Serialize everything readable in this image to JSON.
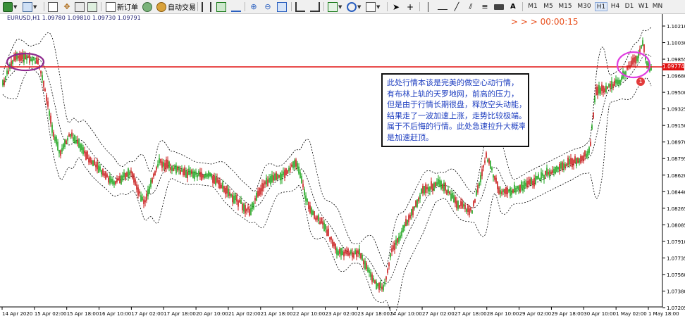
{
  "toolbar": {
    "new_order_label": "新订单",
    "auto_trade_label": "自动交易",
    "timeframes": [
      "M1",
      "M5",
      "M15",
      "M30",
      "H1",
      "H4",
      "D1",
      "W1",
      "MN"
    ],
    "active_timeframe": "H1",
    "text_tool_label": "A"
  },
  "chart": {
    "symbol_label": "EURUSD,H1  1.09780 1.09810 1.09730 1.09791",
    "countdown": "> > >  00:00:15",
    "current_price_label": "1.09774",
    "marker_label": "1",
    "price_labels": [
      "1.10210",
      "1.10030",
      "1.09855",
      "1.09680",
      "1.09500",
      "1.09325",
      "1.09150",
      "1.08970",
      "1.08795",
      "1.08620",
      "1.08440",
      "1.08265",
      "1.08085",
      "1.07910",
      "1.07735",
      "1.07560",
      "1.07380",
      "1.07205"
    ],
    "time_labels": [
      "14 Apr 2020",
      "15 Apr 02:00",
      "15 Apr 18:00",
      "16 Apr 10:00",
      "17 Apr 02:00",
      "17 Apr 18:00",
      "20 Apr 10:00",
      "21 Apr 02:00",
      "21 Apr 18:00",
      "22 Apr 10:00",
      "23 Apr 02:00",
      "23 Apr 18:00",
      "24 Apr 10:00",
      "27 Apr 02:00",
      "27 Apr 18:00",
      "28 Apr 10:00",
      "29 Apr 02:00",
      "29 Apr 18:00",
      "30 Apr 10:00",
      "1 May 02:00",
      "1 May 18:00"
    ],
    "colors": {
      "bull": "#1aa31a",
      "bear": "#c81818",
      "band": "#000000",
      "price_line": "#e01010",
      "annotation_text": "#1f3fc0",
      "countdown": "#e8501e"
    }
  },
  "annotation": {
    "lines": [
      "此处行情本该是完美的做空心动行情，",
      "有布林上轨的天罗地网，前高的压力，",
      "但是由于行情长期很盘，释放空头动能，",
      "结果走了一波加速上涨，走势比较极端。",
      "属于不后悔的行情。此处急速拉升大概率",
      "是加速赶顶。"
    ]
  }
}
